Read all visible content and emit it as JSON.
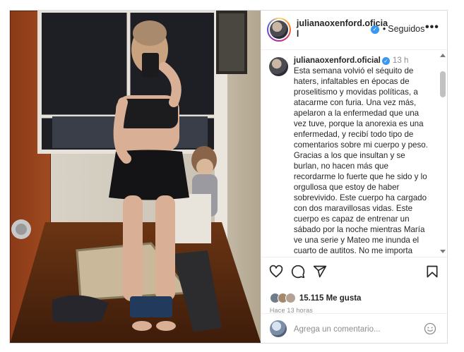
{
  "post": {
    "header": {
      "username": "julianaoxenford.oficial",
      "verified_badge": "✓",
      "following_dot": "•",
      "follow_label": "Seguidos",
      "more_icon": "more-dots-icon",
      "more_glyph": "•••"
    },
    "caption": {
      "username": "julianaoxenford.oficial",
      "verified_badge": "✓",
      "time": "13 h",
      "text": "Esta semana volvió el séquito de haters, infaltables en épocas de proselitismo y movidas políticas, a atacarme con furia. Una vez más, apelaron a la enfermedad que una vez tuve, porque la anorexia es una enfermedad, y recibí todo tipo de comentarios sobre mi cuerpo y peso. Gracias a los que insultan y se burlan, no hacen más que recordarme lo fuerte que he sido y lo orgullosa que estoy de haber sobrevivido. Este cuerpo ha cargado con dos maravillosas vidas. Este cuerpo es capaz de entrenar un sábado por la noche mientras María ve una serie y Mateo me inunda el cuarto de autitos. No me importa tener el cuerpo perfecto. Me importa abrazar el mío y"
    },
    "actions": {
      "like_icon": "heart-icon",
      "comment_icon": "comment-icon",
      "share_icon": "share-icon",
      "save_icon": "bookmark-icon"
    },
    "likes_label": "15.115 Me gusta",
    "time_ago": "Hace 13 horas",
    "comment": {
      "placeholder": "Agrega un comentario...",
      "emoji_icon": "emoji-icon"
    },
    "colors": {
      "verified": "#3897f0",
      "text": "#262626",
      "muted": "#8e8e8e",
      "border": "#dbdbdb"
    }
  }
}
